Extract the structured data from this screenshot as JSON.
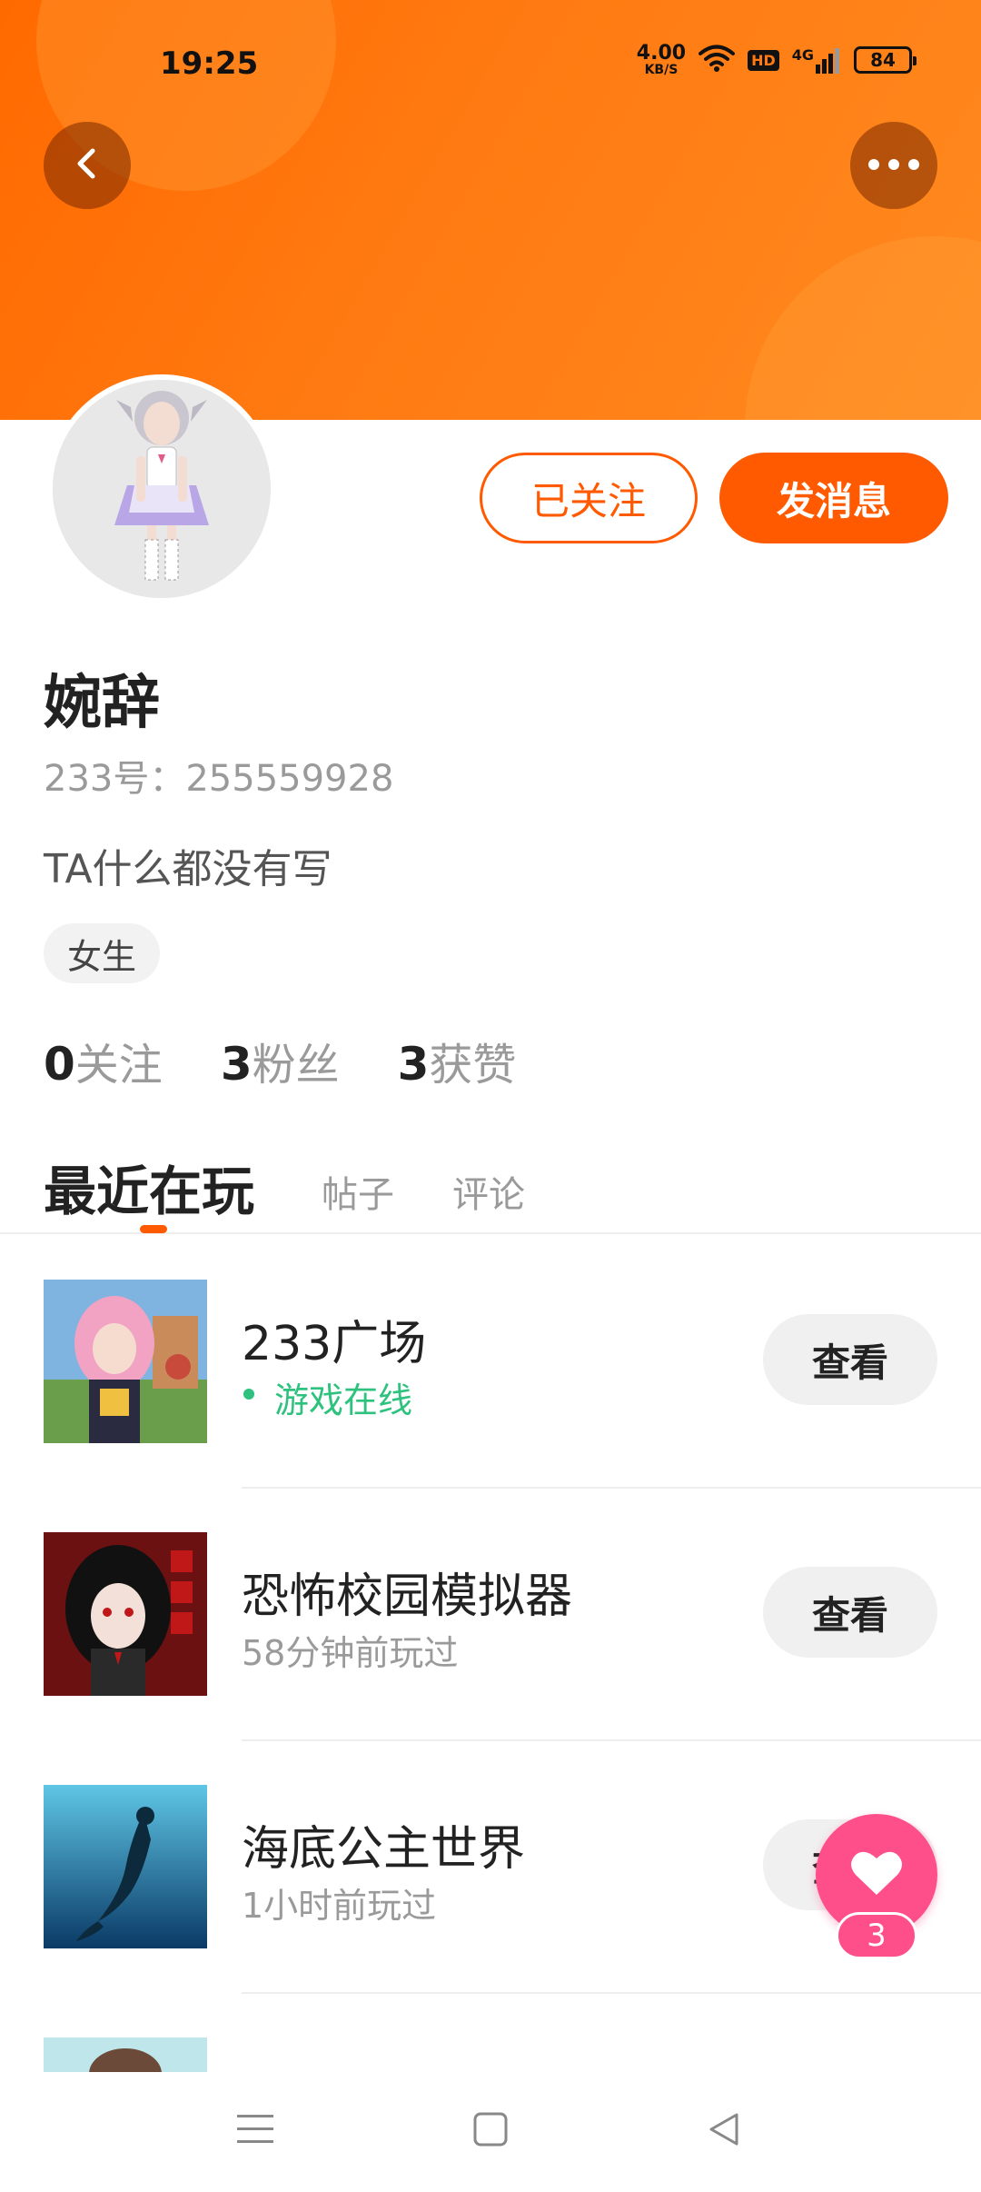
{
  "status_bar": {
    "time": "19:25",
    "net_speed_value": "4.00",
    "net_speed_unit": "KB/S",
    "hd_label": "HD",
    "signal_label": "4G",
    "battery": "84"
  },
  "profile": {
    "name": "婉辞",
    "id_line": "233号：255559928",
    "bio": "TA什么都没有写",
    "gender_tag": "女生",
    "followed_label": "已关注",
    "message_label": "发消息"
  },
  "stats": {
    "following_count": "0",
    "following_label": "关注",
    "followers_count": "3",
    "followers_label": "粉丝",
    "likes_count": "3",
    "likes_label": "获赞"
  },
  "tabs": {
    "active": "最近在玩",
    "posts": "帖子",
    "comments": "评论"
  },
  "games": [
    {
      "title": "233广场",
      "subtitle": "游戏在线",
      "button": "查看"
    },
    {
      "title": "恐怖校园模拟器",
      "subtitle": "58分钟前玩过",
      "button": "查看"
    },
    {
      "title": "海底公主世界",
      "subtitle": "1小时前玩过",
      "button": "查看"
    },
    {
      "title": "",
      "subtitle": "",
      "button": ""
    }
  ],
  "like_fab": {
    "count": "3"
  },
  "colors": {
    "accent": "#ff5a00",
    "online": "#2ec27e",
    "like": "#ff4f8b"
  },
  "icons": {
    "back": "chevron-left-icon",
    "more": "more-dots-icon",
    "like": "heart-icon",
    "nav_menu": "menu-icon",
    "nav_home": "square-icon",
    "nav_back": "triangle-back-icon"
  }
}
